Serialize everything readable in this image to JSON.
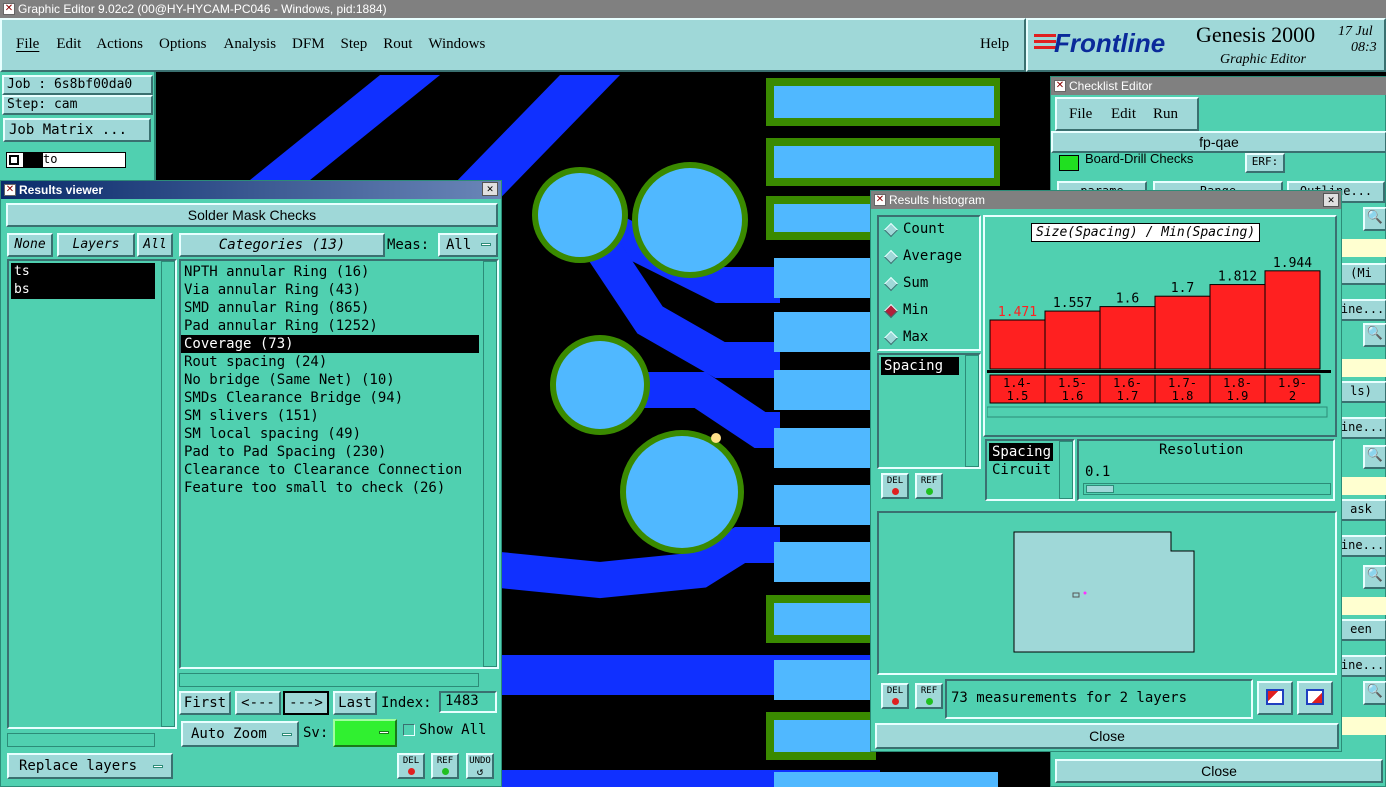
{
  "app": {
    "title": "Graphic Editor 9.02c2 (00@HY-HYCAM-PC046 - Windows, pid:1884)",
    "menu": [
      "File",
      "Edit",
      "Actions",
      "Options",
      "Analysis",
      "DFM",
      "Step",
      "Rout",
      "Windows"
    ],
    "help": "Help",
    "logo": "Frontline",
    "product": "Genesis 2000",
    "subtitle": "Graphic Editor",
    "date": "17 Jul",
    "time": "08:3"
  },
  "left_panel": {
    "job": "Job : 6s8bf00da0",
    "step": "Step: cam",
    "job_matrix": "Job Matrix ...",
    "layer1": "to",
    "layer2": "to"
  },
  "results_viewer": {
    "title": "Results viewer",
    "header": "Solder Mask Checks",
    "none": "None",
    "layers": "Layers",
    "all": "All",
    "categories_label": "Categories (13)",
    "meas_label": "Meas:",
    "meas_value": "All",
    "layer_items": [
      "ts",
      "bs"
    ],
    "category_items": [
      "NPTH annular Ring (16)",
      "Via annular Ring (43)",
      "SMD annular Ring (865)",
      "Pad annular Ring (1252)",
      "Coverage (73)",
      "Rout spacing (24)",
      "No bridge (Same Net) (10)",
      "SMDs Clearance Bridge (94)",
      "SM slivers (151)",
      "SM local spacing (49)",
      "Pad to Pad Spacing (230)",
      "Clearance to Clearance Connection",
      "Feature too small to check (26)"
    ],
    "first": "First",
    "prev": "<---",
    "next": "--->",
    "last": "Last",
    "index_label": "Index:",
    "index_value": "1483",
    "auto_zoom": "Auto Zoom",
    "sv": "Sv:",
    "show_all": "Show All",
    "replace_layers": "Replace layers",
    "del": "DEL",
    "ref": "REF",
    "undo": "UNDO"
  },
  "checklist": {
    "title": "Checklist Editor",
    "menu": [
      "File",
      "Edit",
      "Run"
    ],
    "name": "fp-qae",
    "row1": "Board-Drill Checks",
    "row1b": "ERF:",
    "partial": [
      "parame",
      "Range",
      "Outline...",
      "(Mi",
      "line...",
      "ls)",
      "line...",
      "ask",
      "line...",
      "een",
      "line..."
    ],
    "close": "Close"
  },
  "histogram": {
    "title": "Results histogram",
    "modes": [
      "Count",
      "Average",
      "Sum",
      "Min",
      "Max"
    ],
    "selected_mode": "Min",
    "chart_title": "Size(Spacing) / Min(Spacing)",
    "left_list": [
      "Spacing"
    ],
    "param_list": [
      "Spacing",
      "Circuit"
    ],
    "resolution_label": "Resolution",
    "resolution_value": "0.1",
    "status": "73 measurements for 2 layers",
    "close": "Close",
    "del": "DEL",
    "ref": "REF"
  },
  "chart_data": {
    "type": "bar",
    "title": "Size(Spacing) / Min(Spacing)",
    "categories": [
      "1.4-1.5",
      "1.5-1.6",
      "1.6-1.7",
      "1.7-1.8",
      "1.8-1.9",
      "1.9-2"
    ],
    "category_lines": [
      [
        "1.4-",
        "1.5"
      ],
      [
        "1.5-",
        "1.6"
      ],
      [
        "1.6-",
        "1.7"
      ],
      [
        "1.7-",
        "1.8"
      ],
      [
        "1.8-",
        "1.9"
      ],
      [
        "1.9-",
        "2"
      ]
    ],
    "values": [
      1.471,
      1.557,
      1.6,
      1.7,
      1.812,
      1.944
    ],
    "value_labels": [
      "1.471",
      "1.557",
      "1.6",
      "1.7",
      "1.812",
      "1.944"
    ],
    "ylim": [
      0,
      2.1
    ],
    "bar_color": "#ff2020",
    "highlight_label_color": "#ff2020"
  },
  "colors": {
    "panel": "#50d0b0",
    "button": "#9fd8d8",
    "title_active": "#0a2a6a",
    "title_inactive": "#808080",
    "copper": "#50b8ff",
    "trace": "#1030ff",
    "mask": "#3a8a00"
  }
}
